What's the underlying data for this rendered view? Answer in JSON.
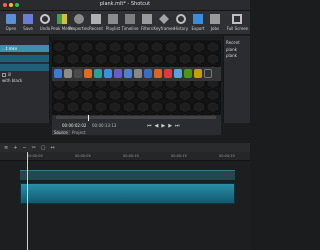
{
  "window": {
    "title": "plank.mlt* - Shotcut"
  },
  "toolbar": {
    "items": [
      {
        "label": "Open"
      },
      {
        "label": "Save"
      },
      {
        "label": "Undo"
      },
      {
        "label": "Peak Meter"
      },
      {
        "label": "Properties"
      },
      {
        "label": "Recent"
      },
      {
        "label": "Playlist"
      },
      {
        "label": "Timeline"
      },
      {
        "label": "Filters"
      },
      {
        "label": "Keyframes"
      },
      {
        "label": "History"
      },
      {
        "label": "Export"
      },
      {
        "label": "Jobs"
      },
      {
        "label": "Full Screen"
      }
    ]
  },
  "left_panel": {
    "selected": "...t.mkv",
    "check_label": "ill",
    "sub_label": "with black"
  },
  "transport": {
    "timecode_current": "00:00:02:02",
    "timecode_total": "00:00:13:13",
    "tab_source": "Source",
    "tab_project": "Project"
  },
  "right_panel": {
    "line1": "Recent",
    "line2": "plank",
    "line3": "plank"
  },
  "timeline": {
    "ruler": [
      "00:00:00",
      "00:00:05",
      "00:00:10",
      "00:00:15",
      "00:00:20"
    ]
  }
}
